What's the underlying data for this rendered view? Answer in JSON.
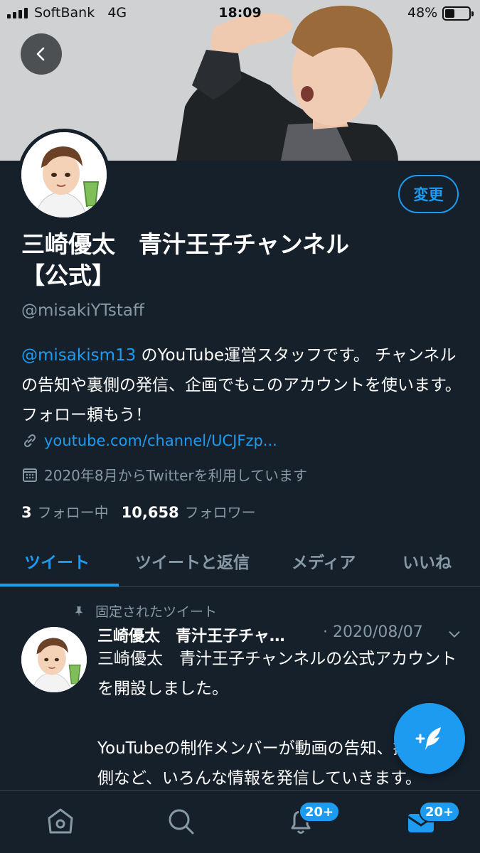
{
  "status_bar": {
    "carrier": "SoftBank",
    "network": "4G",
    "time": "18:09",
    "battery_percent": "48%",
    "battery_level": 0.48
  },
  "profile": {
    "display_name_line1": "三崎優太　青汁王子チャンネル",
    "display_name_line2": "【公式】",
    "handle": "@misakiYTstaff",
    "edit_button_label": "変更",
    "bio_mention": "@misakism13",
    "bio_text": " のYouTube運営スタッフです。 チャンネルの告知や裏側の発信、企画でもこのアカウントを使います。フォロー頼もう！",
    "link": "youtube.com/channel/UCJFzp...",
    "joined": "2020年8月からTwitterを利用しています",
    "following_count": "3",
    "following_label": "フォロー中",
    "followers_count": "10,658",
    "followers_label": "フォロワー"
  },
  "tabs": [
    {
      "label": "ツイート",
      "active": true
    },
    {
      "label": "ツイートと返信",
      "active": false
    },
    {
      "label": "メディア",
      "active": false
    },
    {
      "label": "いいね",
      "active": false
    }
  ],
  "tweet": {
    "pinned_label": "固定されたツイート",
    "author": "三崎優太　青汁王子チャ…",
    "date": "· 2020/08/07",
    "body": "三崎優太　青汁王子チャンネルの公式アカウントを開設しました。\n\nYouTubeの制作メンバーが動画の告知、撮影の裏側など、いろんな情報を発信していきます。"
  },
  "bottom_nav": {
    "notifications_badge": "20+",
    "messages_badge": "20+"
  },
  "colors": {
    "background": "#15202b",
    "accent": "#1d9bf0",
    "secondary_text": "#8899a6"
  },
  "icons": [
    "back-arrow-icon",
    "link-icon",
    "calendar-icon",
    "pin-icon",
    "chevron-down-icon",
    "compose-icon",
    "home-icon",
    "search-icon",
    "bell-icon",
    "mail-icon"
  ]
}
